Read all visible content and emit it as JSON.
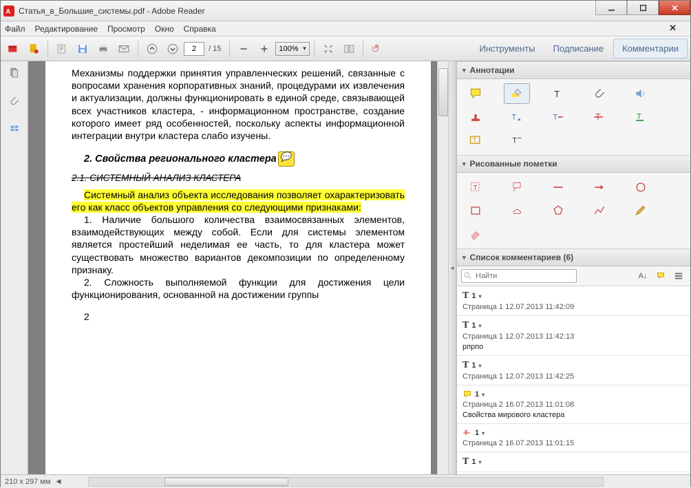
{
  "window": {
    "title": "Статья_в_Большие_системы.pdf - Adobe Reader"
  },
  "menu": {
    "file": "Файл",
    "edit": "Редактирование",
    "view": "Просмотр",
    "window": "Окно",
    "help": "Справка"
  },
  "toolbar": {
    "page_current": "2",
    "page_total": "/ 15",
    "zoom": "100%",
    "instruments": "Инструменты",
    "signing": "Подписание",
    "comments": "Комментарии"
  },
  "document": {
    "para_top": "Механизмы поддержки принятия управленческих решений, связанные с вопросами хранения корпоративных знаний, процедурами их извлечения и актуализации, должны функционировать в единой среде, связывающей всех участников кластера, - информационном пространстве, создание которого имеет ряд особенностей, поскольку аспекты информационной интеграции внутри кластера слабо изучены.",
    "heading2": "2.   Свойства  регионального кластера",
    "heading21": "2.1. СИСТЕМНЫЙ АНАЛИЗ КЛАСТЕРА",
    "hl": "Системный анализ объекта исследования позволяет охарактеризовать его как класс объектов управления со следующими признаками:",
    "item1": "1. Наличие большого количества взаимосвязанных элементов, взаимодействующих между собой. Если для системы элементом является простейший неделимая ее часть, то для кластера может существовать множество вариантов декомпозиции по определенному признаку.",
    "item2": "2. Сложность выполняемой функции для достижения цели функционирования, основанной на достижении группы",
    "pagenum": "2"
  },
  "panels": {
    "annotations": "Аннотации",
    "drawings": "Рисованные пометки",
    "comments_header": "Список комментариев (6)",
    "search_placeholder": "Найти"
  },
  "comments": [
    {
      "type": "T",
      "author": "1",
      "meta": "Страница 1  12.07.2013 11:42:09",
      "body": ""
    },
    {
      "type": "T",
      "author": "1",
      "meta": "Страница 1  12.07.2013 11:42:13",
      "body": "рпрпо"
    },
    {
      "type": "T",
      "author": "1",
      "meta": "Страница 1  12.07.2013 11:42:25",
      "body": ""
    },
    {
      "type": "note",
      "author": "1",
      "meta": "Страница 2  16.07.2013 11:01:08",
      "body": "Свойства мирового кластера"
    },
    {
      "type": "strike",
      "author": "1",
      "meta": "Страница 2  16.07.2013 11:01:15",
      "body": ""
    },
    {
      "type": "T",
      "author": "1",
      "meta": "",
      "body": ""
    }
  ],
  "status": {
    "dimensions": "210 x 297 мм"
  }
}
